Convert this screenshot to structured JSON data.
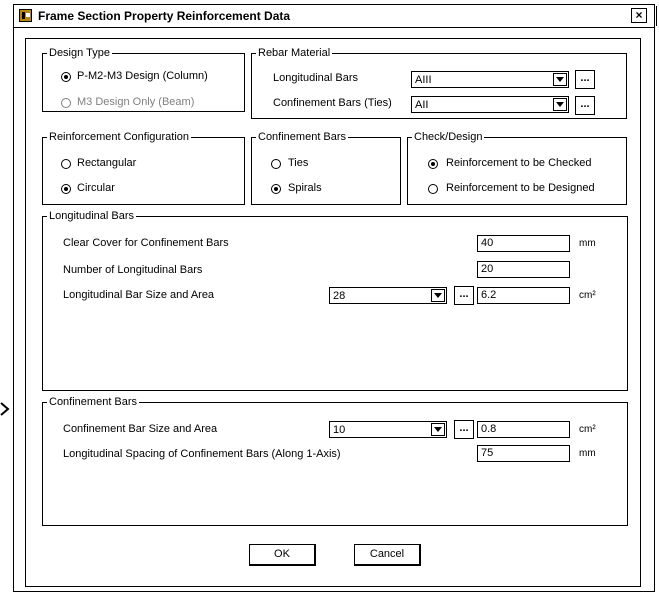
{
  "window": {
    "title": "Frame Section Property Reinforcement Data",
    "close_glyph": "×"
  },
  "design_type": {
    "legend": "Design Type",
    "options": [
      {
        "label": "P-M2-M3 Design  (Column)",
        "checked": true,
        "enabled": true
      },
      {
        "label": "M3 Design Only  (Beam)",
        "checked": false,
        "enabled": false
      }
    ]
  },
  "rebar_material": {
    "legend": "Rebar Material",
    "longitudinal_label": "Longitudinal Bars",
    "longitudinal_value": "AIII",
    "confinement_label": "Confinement Bars (Ties)",
    "confinement_value": "AII",
    "dots": "..."
  },
  "reinforcement_configuration": {
    "legend": "Reinforcement Configuration",
    "options": [
      {
        "label": "Rectangular",
        "checked": false
      },
      {
        "label": "Circular",
        "checked": true
      }
    ]
  },
  "confinement_bars_type": {
    "legend": "Confinement Bars",
    "options": [
      {
        "label": "Ties",
        "checked": false
      },
      {
        "label": "Spirals",
        "checked": true
      }
    ]
  },
  "check_design": {
    "legend": "Check/Design",
    "options": [
      {
        "label": "Reinforcement to be Checked",
        "checked": true
      },
      {
        "label": "Reinforcement to be Designed",
        "checked": false
      }
    ]
  },
  "longitudinal_bars": {
    "legend": "Longitudinal Bars",
    "clear_cover_label": "Clear Cover for Confinement Bars",
    "clear_cover_value": "40",
    "clear_cover_unit": "mm",
    "number_label": "Number of Longitudinal Bars",
    "number_value": "20",
    "size_label": "Longitudinal Bar Size and Area",
    "size_value": "28",
    "area_value": "6.2",
    "area_unit": "cm²",
    "dots": "..."
  },
  "confinement_bars": {
    "legend": "Confinement Bars",
    "size_label": "Confinement Bar Size and Area",
    "size_value": "10",
    "area_value": "0.8",
    "area_unit": "cm²",
    "spacing_label": "Longitudinal Spacing of Confinement Bars  (Along 1-Axis)",
    "spacing_value": "75",
    "spacing_unit": "mm",
    "dots": "..."
  },
  "buttons": {
    "ok": "OK",
    "cancel": "Cancel"
  }
}
